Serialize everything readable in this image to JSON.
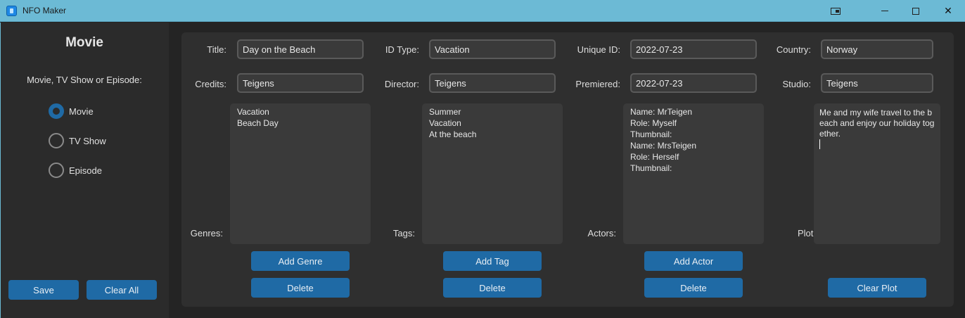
{
  "window": {
    "title": "NFO Maker"
  },
  "sidebar": {
    "heading": "Movie",
    "subheading": "Movie, TV Show or Episode:",
    "options": [
      {
        "label": "Movie",
        "selected": true
      },
      {
        "label": "TV Show",
        "selected": false
      },
      {
        "label": "Episode",
        "selected": false
      }
    ],
    "save_label": "Save",
    "clear_all_label": "Clear All"
  },
  "form": {
    "title_label": "Title:",
    "title_value": "Day on the Beach",
    "id_type_label": "ID Type:",
    "id_type_value": "Vacation",
    "unique_id_label": "Unique ID:",
    "unique_id_value": "2022-07-23",
    "country_label": "Country:",
    "country_value": "Norway",
    "credits_label": "Credits:",
    "credits_value": "Teigens",
    "director_label": "Director:",
    "director_value": "Teigens",
    "premiered_label": "Premiered:",
    "premiered_value": "2022-07-23",
    "studio_label": "Studio:",
    "studio_value": "Teigens"
  },
  "genres": {
    "label": "Genres:",
    "items": [
      "Vacation",
      "Beach Day"
    ],
    "add_label": "Add Genre",
    "delete_label": "Delete"
  },
  "tags": {
    "label": "Tags:",
    "items": [
      "Summer",
      "Vacation",
      "At the beach"
    ],
    "add_label": "Add Tag",
    "delete_label": "Delete"
  },
  "actors": {
    "label": "Actors:",
    "items": [
      "Name: MrTeigen",
      "Role: Myself",
      "Thumbnail:",
      "Name: MrsTeigen",
      "Role: Herself",
      "Thumbnail:"
    ],
    "add_label": "Add Actor",
    "delete_label": "Delete"
  },
  "plot": {
    "label": "Plot:",
    "text": "Me and my wife travel to the beach and enjoy our holiday together.",
    "clear_label": "Clear Plot"
  },
  "colors": {
    "titlebar": "#6cbad5",
    "accent": "#1f6aa5",
    "background": "#242424",
    "panel": "#2f2f2f"
  },
  "icons": {
    "app": "app-icon",
    "snap": "snap-layout-icon",
    "minimize": "minimize-icon",
    "maximize": "maximize-icon",
    "close": "close-icon"
  }
}
